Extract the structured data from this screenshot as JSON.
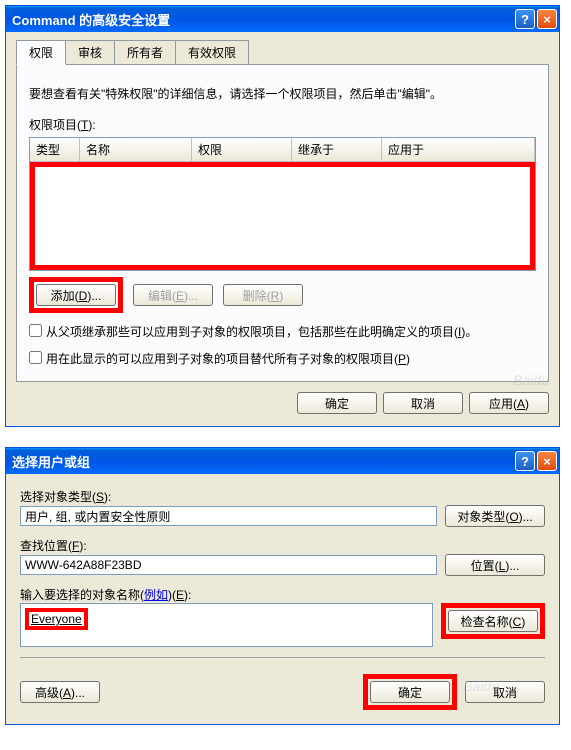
{
  "dialog1": {
    "title": "Command 的高级安全设置",
    "tabs": [
      "权限",
      "审核",
      "所有者",
      "有效权限"
    ],
    "info_text": "要想查看有关\"特殊权限\"的详细信息，请选择一个权限项目，然后单击\"编辑\"。",
    "perm_items_label": "权限项目(T):",
    "columns": {
      "type": "类型",
      "name": "名称",
      "perm": "权限",
      "inherit": "继承于",
      "apply": "应用于"
    },
    "buttons": {
      "add": "添加(D)...",
      "edit": "编辑(E)...",
      "remove": "删除(R)"
    },
    "checkbox1": "从父项继承那些可以应用到子对象的权限项目，包括那些在此明确定义的项目(I)。",
    "checkbox2": "用在此显示的可以应用到子对象的项目替代所有子对象的权限项目(P)",
    "footer": {
      "ok": "确定",
      "cancel": "取消",
      "apply": "应用(A)"
    }
  },
  "dialog2": {
    "title": "选择用户或组",
    "object_type_label": "选择对象类型(S):",
    "object_type_value": "用户, 组, 或内置安全性原则",
    "object_type_btn": "对象类型(O)...",
    "location_label": "查找位置(F):",
    "location_value": "WWW-642A88F23BD",
    "location_btn": "位置(L)...",
    "names_label_pre": "输入要选择的对象名称(",
    "names_label_link": "例如",
    "names_label_post": ")(E):",
    "names_value": "Everyone",
    "check_names_btn": "检查名称(C)",
    "advanced_btn": "高级(A)...",
    "ok": "确定",
    "cancel": "取消"
  }
}
